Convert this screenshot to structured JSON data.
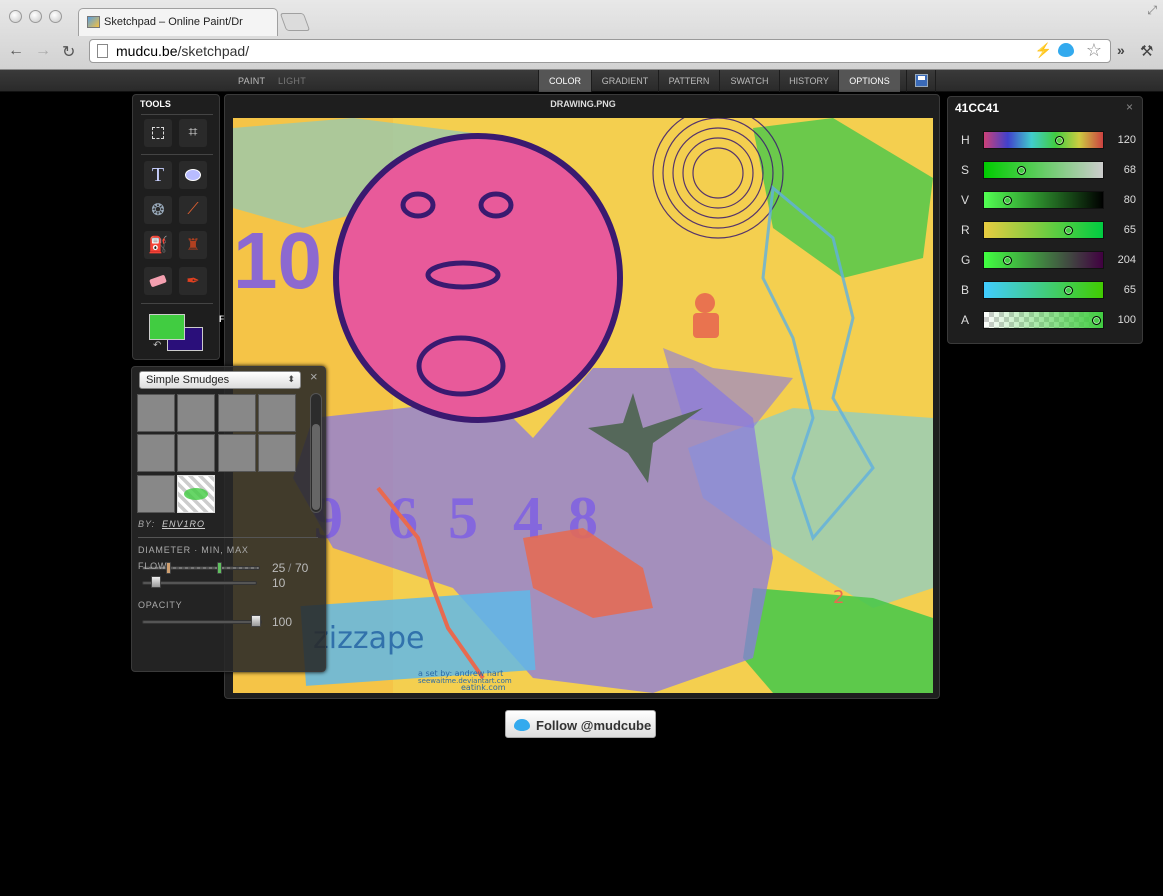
{
  "browser": {
    "tab_title": "Sketchpad – Online Paint/Dr",
    "url_host": "mudcu.be",
    "url_path": "/sketchpad/",
    "back_icon": "←",
    "forward_icon": "→",
    "reload_icon": "↻",
    "more_icon": "»",
    "wrench_icon": "🔧",
    "star_icon": "☆",
    "bolt_icon": "⚡"
  },
  "apptop": {
    "left_menu": [
      "PAINT",
      "LIGHT"
    ],
    "right_menu": [
      "COLOR",
      "GRADIENT",
      "PATTERN",
      "SWATCH",
      "HISTORY",
      "OPTIONS"
    ]
  },
  "tools": {
    "title": "TOOLS",
    "fg_label": "F",
    "fg_color": "#41CC41",
    "bg_color": "#2a0f7a"
  },
  "canvas": {
    "title": "DRAWING.PNG",
    "numbers": [
      "9",
      "6",
      "5",
      "4",
      "8"
    ],
    "stencil_text": "10",
    "zizzape_text": "zizzape",
    "credits": [
      "a set by: andrew hart",
      "seewaitme.deviantart.com",
      "eatink.com"
    ]
  },
  "brushes": {
    "preset": "Simple Smudges",
    "close_icon": "×",
    "by_label": "BY:",
    "author": "ENV1RO",
    "diameter_label": "DIAMETER · MIN, MAX",
    "diameter_min": "25",
    "diameter_sep": "/",
    "diameter_max": "70",
    "flow_label": "FLOW",
    "flow_value": "10",
    "opacity_label": "OPACITY",
    "opacity_value": "100"
  },
  "color": {
    "hex": "41CC41",
    "close_icon": "×",
    "channels": [
      {
        "label": "H",
        "value": "120",
        "pos": 0.66
      },
      {
        "label": "S",
        "value": "68",
        "pos": 0.31
      },
      {
        "label": "V",
        "value": "80",
        "pos": 0.18
      },
      {
        "label": "R",
        "value": "65",
        "pos": 0.74
      },
      {
        "label": "G",
        "value": "204",
        "pos": 0.18
      },
      {
        "label": "B",
        "value": "65",
        "pos": 0.74
      },
      {
        "label": "A",
        "value": "100",
        "pos": 1.0
      }
    ]
  },
  "follow": {
    "label": "Follow @mudcube"
  }
}
